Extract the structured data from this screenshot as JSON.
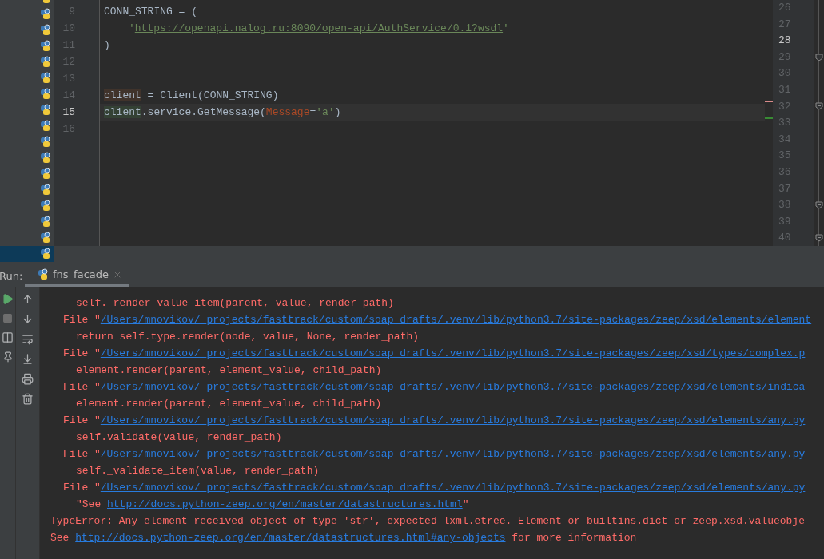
{
  "project_tree": {
    "rows": [
      {
        "selected": false
      },
      {
        "selected": false
      },
      {
        "selected": false
      },
      {
        "selected": false
      },
      {
        "selected": false
      },
      {
        "selected": false
      },
      {
        "selected": false
      },
      {
        "selected": false
      },
      {
        "selected": false
      },
      {
        "selected": false
      },
      {
        "selected": false
      },
      {
        "selected": false
      },
      {
        "selected": false
      },
      {
        "selected": false
      },
      {
        "selected": false
      },
      {
        "selected": false
      },
      {
        "selected": true
      }
    ]
  },
  "editor": {
    "lines": [
      {
        "number": "9",
        "current": false,
        "tokens": [
          {
            "text": "CONN_STRING = (",
            "kind": "plain"
          }
        ]
      },
      {
        "number": "10",
        "current": false,
        "indented": true,
        "tokens": [
          {
            "text": "'",
            "kind": "string"
          },
          {
            "text": "https://openapi.nalog.ru:8090/open-api/AuthService/0.1?wsdl",
            "kind": "link"
          },
          {
            "text": "'",
            "kind": "string"
          }
        ]
      },
      {
        "number": "11",
        "current": false,
        "tokens": [
          {
            "text": ")",
            "kind": "plain"
          }
        ]
      },
      {
        "number": "12",
        "current": false
      },
      {
        "number": "13",
        "current": false
      },
      {
        "number": "14",
        "current": false,
        "error_stripe": true,
        "tokens": [
          {
            "text": "client",
            "kind": "usage_write"
          },
          {
            "text": " = Client(CONN_STRING)",
            "kind": "plain"
          }
        ]
      },
      {
        "number": "15",
        "current": true,
        "change_stripe": true,
        "tokens": [
          {
            "text": "client",
            "kind": "usage_read"
          },
          {
            "text": ".service.GetMessage(",
            "kind": "plain"
          },
          {
            "text": "Message",
            "kind": "param"
          },
          {
            "text": "=",
            "kind": "plain"
          },
          {
            "text": "'a'",
            "kind": "string"
          },
          {
            "text": ")",
            "kind": "plain"
          }
        ]
      },
      {
        "number": "16",
        "current": false
      }
    ]
  },
  "right_pane": {
    "lines": [
      {
        "number": "26",
        "current": false,
        "fold": false
      },
      {
        "number": "27",
        "current": false,
        "fold": false
      },
      {
        "number": "28",
        "current": true,
        "fold": false
      },
      {
        "number": "29",
        "current": false,
        "fold": true
      },
      {
        "number": "30",
        "current": false,
        "fold": false
      },
      {
        "number": "31",
        "current": false,
        "fold": false
      },
      {
        "number": "32",
        "current": false,
        "fold": true
      },
      {
        "number": "33",
        "current": false,
        "fold": false
      },
      {
        "number": "34",
        "current": false,
        "fold": false
      },
      {
        "number": "35",
        "current": false,
        "fold": false
      },
      {
        "number": "36",
        "current": false,
        "fold": false
      },
      {
        "number": "37",
        "current": false,
        "fold": false
      },
      {
        "number": "38",
        "current": false,
        "fold": true
      },
      {
        "number": "39",
        "current": false,
        "fold": false
      },
      {
        "number": "40",
        "current": false,
        "fold": true
      }
    ]
  },
  "run_panel": {
    "label": "Run:",
    "tabs": [
      {
        "label": "fns_facade",
        "selected": true
      }
    ],
    "console": [
      {
        "kind": "code",
        "parts": [
          {
            "text": "self._render_value_item(parent, value, render_path)",
            "link": false
          }
        ]
      },
      {
        "kind": "frame",
        "parts": [
          {
            "text": "File \"",
            "link": false
          },
          {
            "text": "/Users/mnovikov/_projects/fasttrack/custom/soap_drafts/.venv/lib/python3.7/site-packages/zeep/xsd/elements/element",
            "link": true
          }
        ]
      },
      {
        "kind": "code",
        "parts": [
          {
            "text": "return self.type.render(node, value, None, render_path)",
            "link": false
          }
        ]
      },
      {
        "kind": "frame",
        "parts": [
          {
            "text": "File \"",
            "link": false
          },
          {
            "text": "/Users/mnovikov/_projects/fasttrack/custom/soap_drafts/.venv/lib/python3.7/site-packages/zeep/xsd/types/complex.p",
            "link": true
          }
        ]
      },
      {
        "kind": "code",
        "parts": [
          {
            "text": "element.render(parent, element_value, child_path)",
            "link": false
          }
        ]
      },
      {
        "kind": "frame",
        "parts": [
          {
            "text": "File \"",
            "link": false
          },
          {
            "text": "/Users/mnovikov/_projects/fasttrack/custom/soap_drafts/.venv/lib/python3.7/site-packages/zeep/xsd/elements/indica",
            "link": true
          }
        ]
      },
      {
        "kind": "code",
        "parts": [
          {
            "text": "element.render(parent, element_value, child_path)",
            "link": false
          }
        ]
      },
      {
        "kind": "frame",
        "parts": [
          {
            "text": "File \"",
            "link": false
          },
          {
            "text": "/Users/mnovikov/_projects/fasttrack/custom/soap_drafts/.venv/lib/python3.7/site-packages/zeep/xsd/elements/any.py",
            "link": true
          }
        ]
      },
      {
        "kind": "code",
        "parts": [
          {
            "text": "self.validate(value, render_path)",
            "link": false
          }
        ]
      },
      {
        "kind": "frame",
        "parts": [
          {
            "text": "File \"",
            "link": false
          },
          {
            "text": "/Users/mnovikov/_projects/fasttrack/custom/soap_drafts/.venv/lib/python3.7/site-packages/zeep/xsd/elements/any.py",
            "link": true
          }
        ]
      },
      {
        "kind": "code",
        "parts": [
          {
            "text": "self._validate_item(value, render_path)",
            "link": false
          }
        ]
      },
      {
        "kind": "frame",
        "parts": [
          {
            "text": "File \"",
            "link": false
          },
          {
            "text": "/Users/mnovikov/_projects/fasttrack/custom/soap_drafts/.venv/lib/python3.7/site-packages/zeep/xsd/elements/any.py",
            "link": true
          }
        ]
      },
      {
        "kind": "code",
        "parts": [
          {
            "text": "\"See ",
            "link": false
          },
          {
            "text": "http://docs.python-zeep.org/en/master/datastructures.html",
            "link": true
          },
          {
            "text": "\"",
            "link": false
          }
        ]
      },
      {
        "kind": "error",
        "parts": [
          {
            "text": "TypeError: Any element received object of type 'str', expected lxml.etree._Element or builtins.dict or zeep.xsd.valueobje",
            "link": false
          }
        ]
      },
      {
        "kind": "error",
        "parts": [
          {
            "text": "See ",
            "link": false
          },
          {
            "text": "http://docs.python-zeep.org/en/master/datastructures.html#any-objects",
            "link": true
          },
          {
            "text": " for more information",
            "link": false
          }
        ]
      }
    ]
  }
}
